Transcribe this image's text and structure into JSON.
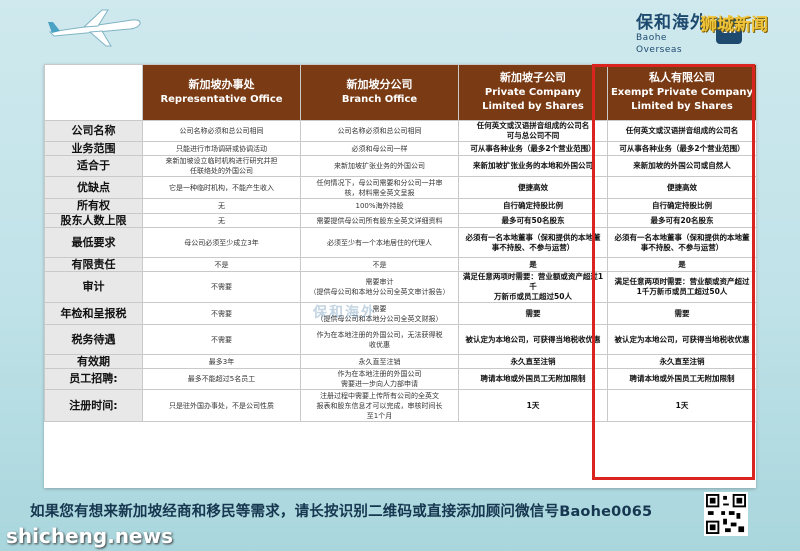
{
  "header": {
    "brand_cn": "保和海外",
    "brand_en": "Baohe Overseas",
    "badge": "BH",
    "watermark": "狮城新闻"
  },
  "columns": [
    {
      "cn": "新加坡办事处",
      "en": "Representative Office",
      "en2": ""
    },
    {
      "cn": "新加坡分公司",
      "en": "Branch Office",
      "en2": ""
    },
    {
      "cn": "新加坡子公司",
      "en": "Private Company",
      "en2": "Limited by Shares"
    },
    {
      "cn": "私人有限公司",
      "en": "Exempt Private Company",
      "en2": "Limited by Shares"
    }
  ],
  "rows": [
    {
      "label": "公司名称",
      "cells": [
        "公司名称必须和总公司相同",
        "公司名称必须和总公司相同",
        "任何英文或汉语拼音组成的公司名\n可与总公司不同",
        "任何英文或汉语拼音组成的公司名"
      ]
    },
    {
      "label": "业务范围",
      "cells": [
        "只能进行市场调研或协调活动",
        "必须和母公司一样",
        "可从事各种业务（最多2个营业范围）",
        "可从事各种业务（最多2个营业范围）"
      ]
    },
    {
      "label": "适合于",
      "cells": [
        "来新加坡设立临时机构进行研究并担\n任联络处的外国公司",
        "来新加坡扩张业务的外国公司",
        "来新加坡扩张业务的本地和外国公司",
        "来新加坡的外国公司或自然人"
      ]
    },
    {
      "label": "优缺点",
      "cells": [
        "它是一种临时机构，不能产生收入",
        "任何情况下，母公司需要和分公司一并审\n核，材料需全英文呈报",
        "便捷高效",
        "便捷高效"
      ]
    },
    {
      "label": "所有权",
      "cells": [
        "无",
        "100%海外持股",
        "自行确定持股比例",
        "自行确定持股比例"
      ]
    },
    {
      "label": "股东人数上限",
      "cells": [
        "无",
        "需要提供母公司所有股东全英文详细资料",
        "最多可有50名股东",
        "最多可有20名股东"
      ]
    },
    {
      "label": "最低要求",
      "cells": [
        "母公司必须至少成立3年",
        "必须至少有一个本地居住的代理人",
        "必须有一名本地董事（保和提供的本地董\n事不持股、不参与运营）",
        "必须有一名本地董事（保和提供的本地董\n事不持股、不参与运营）"
      ]
    },
    {
      "label": "有限责任",
      "cells": [
        "不是",
        "不是",
        "是",
        "是"
      ]
    },
    {
      "label": "审计",
      "cells": [
        "不需要",
        "需要审计\n（提供母公司和本地分公司全英文审计报告）",
        "满足任意两项时需要：营业额或资产超过1千\n万新币或员工超过50人",
        "满足任意两项时需要：营业额或资产超过\n1千万新币或员工超过50人"
      ]
    },
    {
      "label": "年检和呈报税",
      "cells": [
        "不需要",
        "需要\n（提供母公司和本地分公司全英文财报）",
        "需要",
        "需要"
      ]
    },
    {
      "label": "税务待遇",
      "cells": [
        "不需要",
        "作为在本地注册的外国公司，无法获得税\n收优惠",
        "被认定为本地公司，可获得当地税收优惠",
        "被认定为本地公司，可获得当地税收优惠"
      ]
    },
    {
      "label": "有效期",
      "cells": [
        "最多3年",
        "永久直至注销",
        "永久直至注销",
        "永久直至注销"
      ]
    },
    {
      "label": "员工招聘:",
      "cells": [
        "最多不能超过5名员工",
        "作为在本地注册的外国公司\n需要进一步向人力部申请",
        "聘请本地或外国员工无附加限制",
        "聘请本地或外国员工无附加限制"
      ]
    },
    {
      "label": "注册时间:",
      "cells": [
        "只是驻外国办事处，不是公司性质",
        "注册过程中需要上传所有公司的全英文\n报表和股东信息才可以完成，审核时间长\n至1个月",
        "1天",
        "1天"
      ]
    }
  ],
  "footer": "如果您有想来新加坡经商和移民等需求，请长按识别二维码或直接添加顾问微信号Baohe0065",
  "site": "shicheng.news",
  "watermark_mid": "保和海外"
}
